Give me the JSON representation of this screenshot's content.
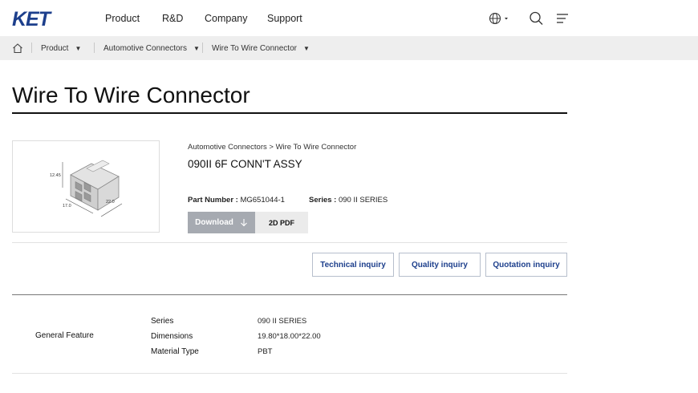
{
  "header": {
    "logo": "KET",
    "nav": [
      "Product",
      "R&D",
      "Company",
      "Support"
    ]
  },
  "breadcrumb": {
    "items": [
      "Product",
      "Automotive Connectors",
      "Wire To Wire Connector"
    ]
  },
  "page": {
    "title": "Wire To Wire Connector"
  },
  "product": {
    "category_path": "Automotive Connectors > Wire To Wire Connector",
    "name": "090II 6F CONN'T ASSY",
    "part_number_label": "Part Number :",
    "part_number": "MG651044-1",
    "series_label": "Series :",
    "series": "090 II SERIES",
    "download_label": "Download",
    "pdf_label": "2D PDF",
    "drawing_dims": [
      "12.45",
      "17.0",
      "22.0"
    ]
  },
  "inquiry": {
    "technical": "Technical inquiry",
    "quality": "Quality inquiry",
    "quotation": "Quotation inquiry"
  },
  "specs": {
    "section": "General Feature",
    "rows": [
      {
        "label": "Series",
        "value": "090 II SERIES"
      },
      {
        "label": "Dimensions",
        "value": "19.80*18.00*22.00"
      },
      {
        "label": "Material Type",
        "value": "PBT"
      }
    ]
  }
}
